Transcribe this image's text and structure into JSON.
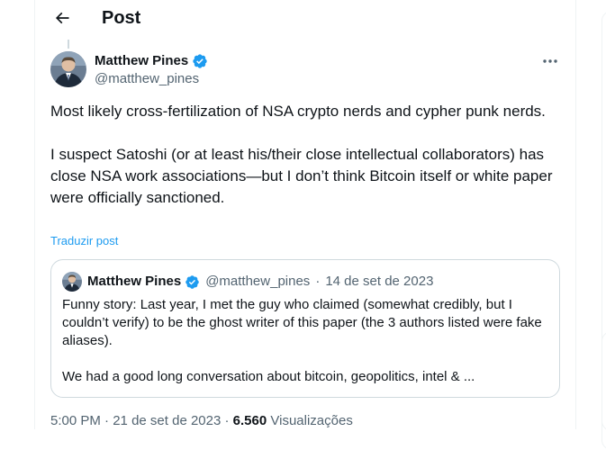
{
  "header": {
    "title": "Post",
    "back_icon": "arrow-left-icon"
  },
  "tweet": {
    "author": {
      "name": "Matthew Pines",
      "handle": "@matthew_pines",
      "verified": true
    },
    "text": "Most likely cross-fertilization of NSA crypto nerds and cypher punk nerds.\n\nI suspect Satoshi (or at least his/their close intellectual collaborators) has close NSA work associations—but I don’t think Bitcoin itself or white paper were officially sanctioned.",
    "translate_label": "Traduzir post",
    "time": "5:00 PM",
    "separator": "·",
    "date": "21 de set de 2023",
    "views_count": "6.560",
    "views_label": "Visualizações"
  },
  "quote": {
    "author": {
      "name": "Matthew Pines",
      "handle": "@matthew_pines",
      "verified": true
    },
    "separator": "·",
    "date": "14 de set de 2023",
    "text": "Funny story: Last year, I met the guy who claimed (somewhat credibly, but I couldn’t verify) to be the ghost writer of this paper (the 3 authors listed were fake aliases).\n\nWe had a good long conversation about bitcoin, geopolitics, intel & ..."
  },
  "colors": {
    "accent": "#1d9bf0",
    "text": "#0f1419",
    "secondary": "#536471",
    "border": "#cfd9de"
  }
}
